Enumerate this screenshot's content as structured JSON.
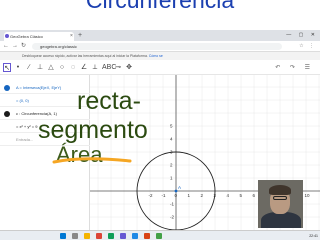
{
  "overlay": {
    "top_title": "Circunferencia",
    "annot_recta": "recta-",
    "annot_segmento": "segmento",
    "annot_area": "Área"
  },
  "browser": {
    "tab_title": "GeoGebra Clásico",
    "url": "geogebra.org/classic",
    "notice_text": "Desbloquear acceso rápido, activar las herramientas aquí al iniciar la Plataforma.",
    "notice_link": "Cómo se"
  },
  "algebra": {
    "rows": [
      {
        "text": "A = Interseca(EjeX, EjeY)",
        "color": "#1565c0"
      },
      {
        "text": "= (0, 0)",
        "color": "#1565c0"
      },
      {
        "text": "c : Circunferencia(A, 1)",
        "color": "#1b1b1b"
      },
      {
        "text": "= x² + y² = 9",
        "color": "#1b1b1b"
      }
    ],
    "input_placeholder": "Entrada..."
  },
  "graphics": {
    "x_ticks": [
      "-2",
      "-1",
      "0",
      "1",
      "2",
      "3",
      "4",
      "5",
      "6",
      "7",
      "8",
      "9",
      "10"
    ],
    "y_ticks": [
      "5",
      "4",
      "3",
      "2",
      "1",
      "-1",
      "-2",
      "-3"
    ],
    "point_label": "A",
    "circle": {
      "cx": 0,
      "cy": 0,
      "r": 3
    },
    "axis_color": "#555555",
    "circle_color": "#222222"
  },
  "colors": {
    "accent": "#6557d2",
    "annotation": "#2b4a10",
    "strike": "#f5a623"
  },
  "taskbar": {
    "clock": "22:41"
  }
}
